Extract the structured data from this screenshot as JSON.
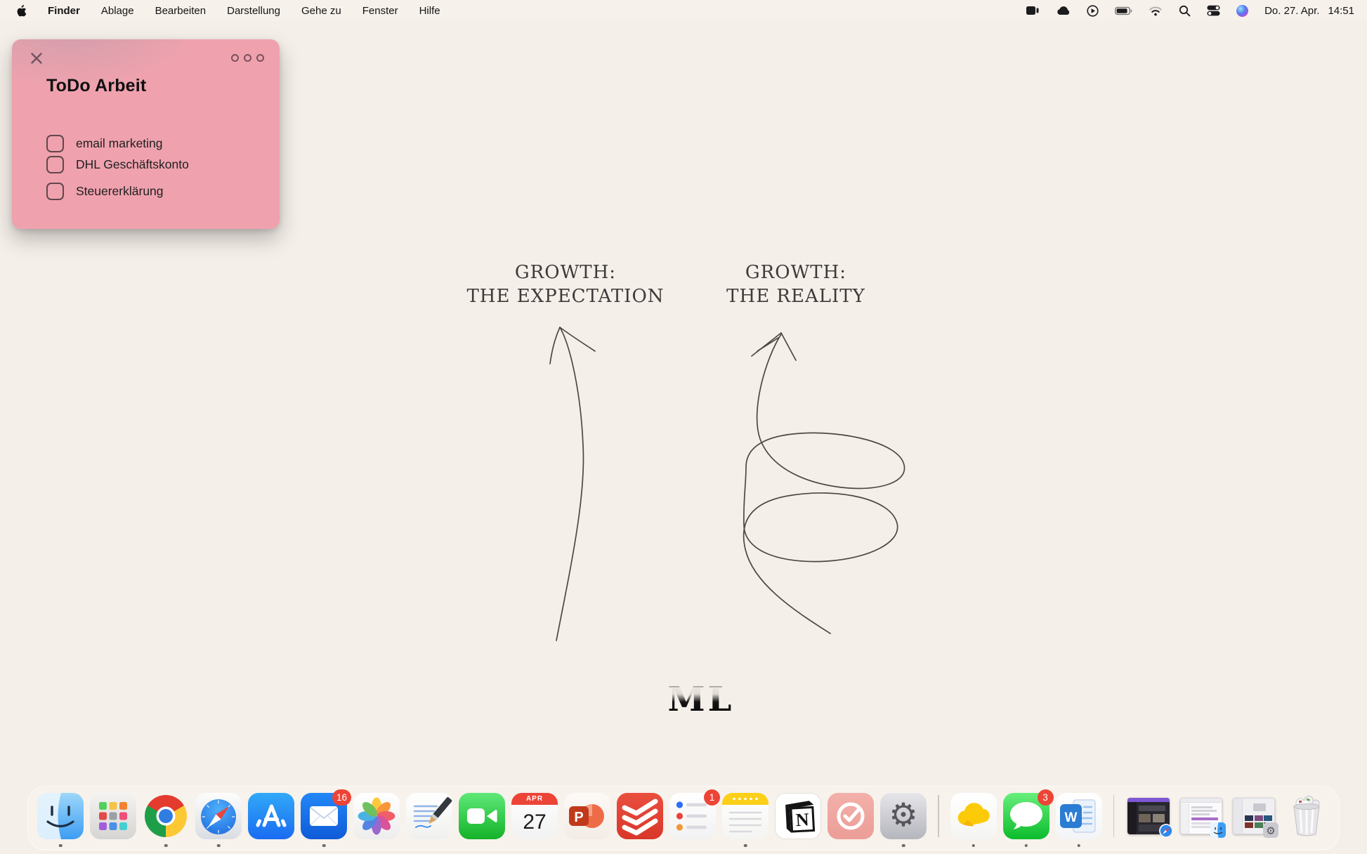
{
  "menubar": {
    "items": [
      {
        "label": "Finder"
      },
      {
        "label": "Ablage"
      },
      {
        "label": "Bearbeiten"
      },
      {
        "label": "Darstellung"
      },
      {
        "label": "Gehe zu"
      },
      {
        "label": "Fenster"
      },
      {
        "label": "Hilfe"
      }
    ],
    "status_icons": [
      "video-camera",
      "cloud",
      "play-circle",
      "battery",
      "wifi",
      "search",
      "control-center",
      "siri"
    ],
    "clock_date": "Do. 27. Apr.",
    "clock_time": "14:51"
  },
  "sticky_note": {
    "title": "ToDo Arbeit",
    "color": "#efa2ae",
    "items": [
      {
        "label": "email marketing",
        "checked": false
      },
      {
        "label": "DHL Geschäftskonto",
        "checked": false
      },
      {
        "label": "Steuererklärung",
        "checked": false
      }
    ]
  },
  "wallpaper": {
    "background": "#f5efe9",
    "heading_left_line1": "GROWTH:",
    "heading_left_line2": "THE EXPECTATION",
    "heading_right_line1": "GROWTH:",
    "heading_right_line2": "THE REALITY",
    "logo": "ML"
  },
  "dock": {
    "items": [
      {
        "name": "finder",
        "running": true
      },
      {
        "name": "launchpad",
        "running": false
      },
      {
        "name": "chrome",
        "running": true
      },
      {
        "name": "safari",
        "running": true
      },
      {
        "name": "app-store",
        "glyph": "A",
        "running": false
      },
      {
        "name": "mail",
        "badge": "16",
        "running": true
      },
      {
        "name": "photos",
        "running": false
      },
      {
        "name": "textedit",
        "running": false
      },
      {
        "name": "facetime",
        "running": false
      },
      {
        "name": "calendar",
        "month": "APR",
        "day": "27",
        "running": false
      },
      {
        "name": "powerpoint",
        "glyph": "P",
        "running": false
      },
      {
        "name": "todoist",
        "running": false
      },
      {
        "name": "reminders",
        "badge": "1",
        "running": false
      },
      {
        "name": "notes",
        "running": true
      },
      {
        "name": "notion",
        "glyph": "N",
        "running": false
      },
      {
        "name": "task-check",
        "running": false
      },
      {
        "name": "system-settings",
        "running": true
      },
      {
        "name": "cloud-drive",
        "running": true
      },
      {
        "name": "messages",
        "badge": "3",
        "running": true
      },
      {
        "name": "word",
        "glyph": "W",
        "running": true
      },
      {
        "name": "minimized-window-safari",
        "running": false
      },
      {
        "name": "minimized-window-finder",
        "running": false
      },
      {
        "name": "minimized-window-settings",
        "running": false
      },
      {
        "name": "trash",
        "running": false
      }
    ]
  }
}
